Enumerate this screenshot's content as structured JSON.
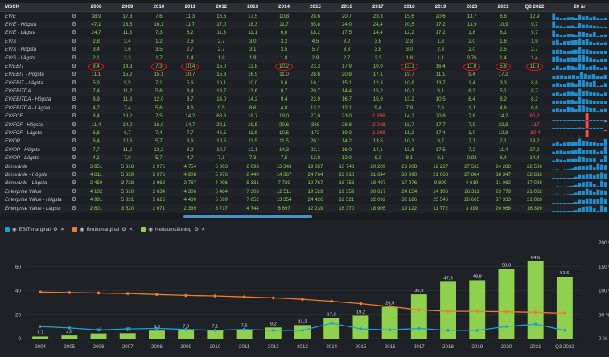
{
  "table": {
    "header_label": "MSCK",
    "years": [
      "2008",
      "2009",
      "2010",
      "2011",
      "2012",
      "2013",
      "2014",
      "2015",
      "2016",
      "2017",
      "2018",
      "2019",
      "2020",
      "2021",
      "Q3 2022"
    ],
    "spark_header": "20 år",
    "rows": [
      {
        "label": "EV/E",
        "values": [
          "38,9",
          "17,3",
          "7,6",
          "11,3",
          "16,6",
          "17,5",
          "10,8",
          "28,6",
          "20,7",
          "23,3",
          "15,6",
          "20,6",
          "13,7",
          "6,8",
          "12,9"
        ]
      },
      {
        "label": "EV/E - Högsta",
        "values": [
          "47,1",
          "18,6",
          "16,1",
          "11,7",
          "17,0",
          "18,3",
          "11,7",
          "35,8",
          "24,0",
          "24,4",
          "20,5",
          "17,2",
          "13,9",
          "10,9",
          "9,7"
        ]
      },
      {
        "label": "EV/E - Lägsta",
        "values": [
          "24,7",
          "11,8",
          "7,3",
          "6,2",
          "11,3",
          "11,1",
          "6,0",
          "18,2",
          "17,5",
          "14,4",
          "12,2",
          "17,2",
          "1,8",
          "6,1",
          "9,7"
        ]
      },
      {
        "label": "EV/S",
        "values": [
          "2,8",
          "3,4",
          "1,2",
          "2,6",
          "2,7",
          "3,0",
          "3,2",
          "4,5",
          "3,2",
          "3,8",
          "2,3",
          "1,3",
          "2,0",
          "1,6",
          "1,9"
        ]
      },
      {
        "label": "EV/S - Högsta",
        "values": [
          "3,4",
          "3,6",
          "3,5",
          "2,7",
          "2,7",
          "3,1",
          "3,5",
          "5,7",
          "3,8",
          "3,8",
          "3,0",
          "2,3",
          "2,0",
          "2,5",
          "2,7"
        ]
      },
      {
        "label": "EV/S - Lägsta",
        "values": [
          "2,1",
          "2,3",
          "1,7",
          "1,4",
          "1,8",
          "1,9",
          "1,8",
          "2,9",
          "2,7",
          "2,3",
          "1,8",
          "1,1",
          "0,76",
          "1,4",
          "1,4"
        ]
      },
      {
        "label": "EV/EBIT",
        "values": [
          "8,4",
          "14,3",
          "7,3",
          "10,4",
          "15,0",
          "13,8",
          "10,2",
          "23,3",
          "17,9",
          "10,9",
          "13,1",
          "16,4",
          "11,0",
          "5,8",
          "11,8"
        ],
        "circled": [
          0,
          2,
          3,
          6,
          10,
          12,
          13,
          14
        ]
      },
      {
        "label": "EV/EBIT - Högsta",
        "values": [
          "11,1",
          "15,2",
          "15,1",
          "10,7",
          "15,3",
          "16,5",
          "11,0",
          "28,6",
          "20,8",
          "17,1",
          "19,7",
          "11,1",
          "9,4",
          "17,2",
          ""
        ]
      },
      {
        "label": "EV/EBIT - Lägsta",
        "values": [
          "5,9",
          "9,5",
          "7,1",
          "5,6",
          "10,1",
          "10,0",
          "5,6",
          "16,1",
          "15,1",
          "12,3",
          "10,8",
          "13,7",
          "1,4",
          "3,3",
          "8,8"
        ]
      },
      {
        "label": "EV/EBITDA",
        "values": [
          "7,4",
          "11,2",
          "5,6",
          "8,4",
          "13,7",
          "13,6",
          "8,7",
          "20,7",
          "14,4",
          "15,2",
          "10,1",
          "9,1",
          "8,2",
          "5,1",
          "8,7"
        ]
      },
      {
        "label": "EV/EBITDA - Högsta",
        "values": [
          "8,9",
          "11,8",
          "12,0",
          "8,7",
          "14,0",
          "14,2",
          "9,4",
          "23,9",
          "16,7",
          "15,9",
          "13,2",
          "10,5",
          "8,4",
          "8,2",
          "8,2"
        ]
      },
      {
        "label": "EV/EBITDA - Lägsta",
        "values": [
          "4,7",
          "7,4",
          "5,6",
          "4,6",
          "9,5",
          "8,6",
          "4,8",
          "13,2",
          "12,1",
          "9,4",
          "7,9",
          "7,6",
          "1,1",
          "4,6",
          "6,8"
        ]
      },
      {
        "label": "EV/FCF",
        "values": [
          "8,4",
          "13,2",
          "7,5",
          "14,2",
          "68,6",
          "18,7",
          "19,0",
          "27,0",
          "23,0",
          "-1 956",
          "14,2",
          "20,8",
          "7,8",
          "14,2",
          "80,2"
        ],
        "red": [
          9,
          14
        ]
      },
      {
        "label": "EV/FCF - Högsta",
        "values": [
          "11,4",
          "14,0",
          "16,0",
          "14,7",
          "20,1",
          "19,5",
          "20,6",
          "338",
          "26,8",
          "-2 048",
          "18,7",
          "17,7",
          "7,9",
          "22,8",
          "-117"
        ],
        "red": [
          9,
          14
        ]
      },
      {
        "label": "EV/FCF - Lägsta",
        "values": [
          "6,6",
          "8,7",
          "7,4",
          "7,7",
          "46,5",
          "11,8",
          "10,5",
          "172",
          "19,3",
          "-1 208",
          "11,2",
          "17,4",
          "1,0",
          "12,8",
          "-50,4"
        ],
        "red": [
          9,
          14
        ]
      },
      {
        "label": "EV/OP",
        "values": [
          "6,4",
          "10,6",
          "5,7",
          "8,6",
          "10,5",
          "11,5",
          "11,5",
          "20,1",
          "14,2",
          "13,5",
          "10,3",
          "9,7",
          "7,1",
          "7,1",
          "19,2"
        ]
      },
      {
        "label": "EV/OP - Högsta",
        "values": [
          "7,7",
          "11,2",
          "12,3",
          "8,9",
          "10,7",
          "12,1",
          "14,3",
          "23,1",
          "16,0",
          "14,1",
          "13,6",
          "17,5",
          "7,2",
          "11,4",
          "27,9"
        ]
      },
      {
        "label": "EV/OP - Lägsta",
        "values": [
          "4,1",
          "7,0",
          "5,7",
          "4,7",
          "7,1",
          "7,3",
          "7,5",
          "12,8",
          "12,0",
          "8,3",
          "8,1",
          "8,1",
          "0,92",
          "6,4",
          "14,4"
        ]
      },
      {
        "label": "Börsvärde",
        "values": [
          "3 951",
          "5 318",
          "2 975",
          "4 754",
          "5 863",
          "8 093",
          "13 343",
          "19 857",
          "16 748",
          "20 209",
          "23 208",
          "12 227",
          "27 533",
          "24 288",
          "22 506"
        ]
      },
      {
        "label": "Börsvärde - Högsta",
        "values": [
          "4 811",
          "5 839",
          "5 976",
          "4 908",
          "5 976",
          "8 440",
          "14 367",
          "24 764",
          "22 918",
          "31 644",
          "30 990",
          "21 668",
          "27 884",
          "38 347",
          "32 882"
        ]
      },
      {
        "label": "Börsvärde - Lägsta",
        "values": [
          "2 450",
          "3 728",
          "2 962",
          "2 787",
          "4 096",
          "5 331",
          "7 729",
          "12 767",
          "16 758",
          "18 497",
          "17 976",
          "9 899",
          "4 619",
          "21 062",
          "17 098"
        ]
      },
      {
        "label": "Enterprise Value",
        "values": [
          "4 102",
          "5 310",
          "2 634",
          "4 306",
          "5 484",
          "7 306",
          "12 511",
          "19 529",
          "19 359",
          "30 617",
          "24 154",
          "14 106",
          "26 311",
          "23 779",
          "21 062"
        ]
      },
      {
        "label": "Enterprise Value - Högsta",
        "values": [
          "4 981",
          "5 831",
          "5 625",
          "4 480",
          "5 599",
          "7 852",
          "13 354",
          "24 426",
          "22 521",
          "32 092",
          "32 186",
          "25 546",
          "26 665",
          "37 333",
          "31 828"
        ]
      },
      {
        "label": "Enterprise Value - Lägsta",
        "values": [
          "2 601",
          "3 520",
          "2 671",
          "2 339",
          "3 717",
          "4 744",
          "6 897",
          "12 239",
          "16 370",
          "18 905",
          "19 122",
          "11 772",
          "3 399",
          "20 968",
          "16 399"
        ]
      }
    ]
  },
  "legend": [
    {
      "label": "EBIT-marginal",
      "color": "#1f9fd6"
    },
    {
      "label": "Bruttomarginal",
      "color": "#f07b2a"
    },
    {
      "label": "Nettoomsättning",
      "color": "#8fd14f"
    }
  ],
  "chart_data": {
    "type": "bar",
    "categories": [
      "2004",
      "2005",
      "2006",
      "2007",
      "2008",
      "2009",
      "2010",
      "2011",
      "2012",
      "2013",
      "2014",
      "2015",
      "2016",
      "2017",
      "2018",
      "2019",
      "2020",
      "2021",
      "Q3 2022"
    ],
    "series": [
      {
        "name": "Nettoomsättning",
        "kind": "bar",
        "axis": "left",
        "color": "#8fd14f",
        "values": [
          1.7,
          2.6,
          4.3,
          4.5,
          6.6,
          7.0,
          7.1,
          7.6,
          9.2,
          11.2,
          17.2,
          19.2,
          26.5,
          36.9,
          47.5,
          48.8,
          58.0,
          64.6,
          51.6
        ]
      },
      {
        "name": "Bruttomarginal",
        "kind": "line",
        "axis": "right",
        "color": "#f07b2a",
        "values": [
          97,
          96,
          95,
          94,
          92,
          90,
          89,
          87,
          85,
          82,
          78,
          73,
          67,
          60,
          57,
          57,
          56,
          55,
          53
        ]
      },
      {
        "name": "EBIT-marginal",
        "kind": "line",
        "axis": "right",
        "color": "#1f9fd6",
        "values": [
          25,
          22,
          18,
          20,
          21,
          19,
          17,
          19,
          17,
          17,
          32,
          20,
          18,
          21,
          17,
          17,
          25,
          30,
          17
        ]
      }
    ],
    "data_labels": [
      "1,7",
      "2,6",
      "4,3",
      "4,5",
      "6,6",
      "7,0",
      "7,1",
      "7,6",
      "9,2",
      "11,2",
      "17,2",
      "19,2",
      "26,5",
      "36,9",
      "47,5",
      "48,8",
      "58,0",
      "64,6",
      "51,6"
    ],
    "left_axis": {
      "ticks": [
        "0",
        "20",
        "40",
        "60"
      ],
      "ylim": [
        0,
        80
      ]
    },
    "right_axis": {
      "ticks": [
        "0 %",
        "50 %",
        "100 %",
        "150 %",
        "200 %"
      ],
      "ylim": [
        0,
        200
      ]
    }
  }
}
